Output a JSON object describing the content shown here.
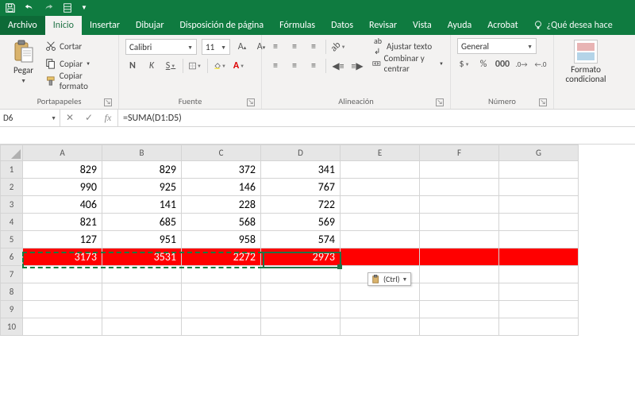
{
  "titlebar": {
    "tooltip": "Guardar"
  },
  "menu": {
    "file": "Archivo",
    "tabs": [
      "Inicio",
      "Insertar",
      "Dibujar",
      "Disposición de página",
      "Fórmulas",
      "Datos",
      "Revisar",
      "Vista",
      "Ayuda",
      "Acrobat"
    ],
    "tell": "¿Qué desea hace",
    "active_index": 0
  },
  "ribbon": {
    "clipboard": {
      "label": "Portapapeles",
      "paste": "Pegar",
      "cut": "Cortar",
      "copy": "Copiar",
      "format_painter": "Copiar formato"
    },
    "font": {
      "label": "Fuente",
      "name": "Calibri",
      "size": "11",
      "bold": "N",
      "italic": "K",
      "underline": "S"
    },
    "alignment": {
      "label": "Alineación",
      "wrap": "Ajustar texto",
      "merge": "Combinar y centrar"
    },
    "number": {
      "label": "Número",
      "format": "General"
    },
    "styles": {
      "cond_format": "Formato\ncondicional"
    }
  },
  "formula_bar": {
    "cell_ref": "D6",
    "formula": "=SUMA(D1:D5)"
  },
  "grid": {
    "columns": [
      "A",
      "B",
      "C",
      "D",
      "E",
      "F",
      "G"
    ],
    "rows": [
      {
        "n": 1,
        "cells": [
          "829",
          "829",
          "372",
          "341",
          "",
          "",
          ""
        ]
      },
      {
        "n": 2,
        "cells": [
          "990",
          "925",
          "146",
          "767",
          "",
          "",
          ""
        ]
      },
      {
        "n": 3,
        "cells": [
          "406",
          "141",
          "228",
          "722",
          "",
          "",
          ""
        ]
      },
      {
        "n": 4,
        "cells": [
          "821",
          "685",
          "568",
          "569",
          "",
          "",
          ""
        ]
      },
      {
        "n": 5,
        "cells": [
          "127",
          "951",
          "958",
          "574",
          "",
          "",
          ""
        ]
      },
      {
        "n": 6,
        "cells": [
          "3173",
          "3531",
          "2272",
          "2973",
          "",
          "",
          ""
        ],
        "sum": true
      },
      {
        "n": 7,
        "cells": [
          "",
          "",
          "",
          "",
          "",
          "",
          ""
        ]
      },
      {
        "n": 8,
        "cells": [
          "",
          "",
          "",
          "",
          "",
          "",
          ""
        ]
      },
      {
        "n": 9,
        "cells": [
          "",
          "",
          "",
          "",
          "",
          "",
          ""
        ]
      },
      {
        "n": 10,
        "cells": [
          "",
          "",
          "",
          "",
          "",
          "",
          ""
        ]
      }
    ]
  },
  "smarttag": {
    "label": "(Ctrl)"
  },
  "colors": {
    "brand": "#0f7b40",
    "accent": "#217346",
    "sum_bg": "#ff0000"
  }
}
